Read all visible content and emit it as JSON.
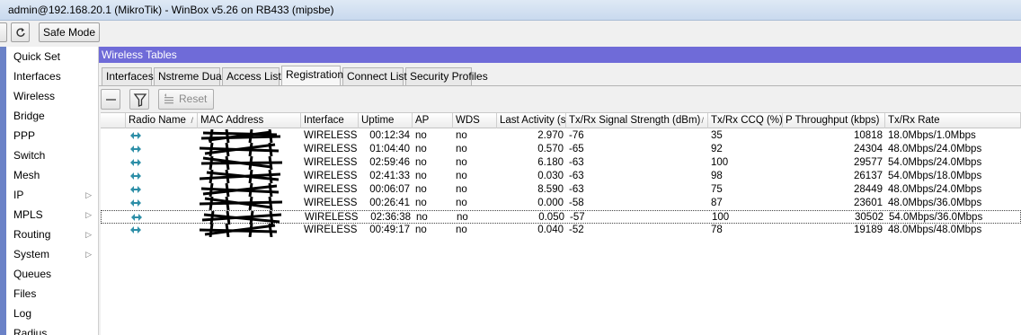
{
  "titlebar": {
    "title": "admin@192.168.20.1 (MikroTik) - WinBox v5.26 on RB433 (mipsbe)"
  },
  "toolbar": {
    "safe_mode_label": "Safe Mode"
  },
  "menu": {
    "items": [
      {
        "label": "Quick Set",
        "submenu": false
      },
      {
        "label": "Interfaces",
        "submenu": false
      },
      {
        "label": "Wireless",
        "submenu": false
      },
      {
        "label": "Bridge",
        "submenu": false
      },
      {
        "label": "PPP",
        "submenu": false
      },
      {
        "label": "Switch",
        "submenu": false
      },
      {
        "label": "Mesh",
        "submenu": false
      },
      {
        "label": "IP",
        "submenu": true
      },
      {
        "label": "MPLS",
        "submenu": true
      },
      {
        "label": "Routing",
        "submenu": true
      },
      {
        "label": "System",
        "submenu": true
      },
      {
        "label": "Queues",
        "submenu": false
      },
      {
        "label": "Files",
        "submenu": false
      },
      {
        "label": "Log",
        "submenu": false
      },
      {
        "label": "Radius",
        "submenu": false
      }
    ]
  },
  "window": {
    "title": "Wireless Tables",
    "tabs": [
      "Interfaces",
      "Nstreme Dual",
      "Access List",
      "Registration",
      "Connect List",
      "Security Profiles"
    ],
    "active_tab": "Registration",
    "reset_label": "Reset"
  },
  "table": {
    "columns": [
      "Radio Name",
      "MAC Address",
      "Interface",
      "Uptime",
      "AP",
      "WDS",
      "Last Activity (s)",
      "Tx/Rx Signal Strength (dBm)",
      "Tx/Rx CCQ (%)",
      "P Throughput (kbps)",
      "Tx/Rx Rate"
    ],
    "rows": [
      {
        "radio_name": "",
        "mac": "",
        "interface": "WIRELESS",
        "uptime": "00:12:34",
        "ap": "no",
        "wds": "no",
        "last_activity": "2.970",
        "signal": "-76",
        "ccq": "35",
        "throughput": "10818",
        "rate": "18.0Mbps/1.0Mbps"
      },
      {
        "radio_name": "",
        "mac": "",
        "interface": "WIRELESS",
        "uptime": "01:04:40",
        "ap": "no",
        "wds": "no",
        "last_activity": "0.570",
        "signal": "-65",
        "ccq": "92",
        "throughput": "24304",
        "rate": "48.0Mbps/24.0Mbps"
      },
      {
        "radio_name": "",
        "mac": "",
        "interface": "WIRELESS",
        "uptime": "02:59:46",
        "ap": "no",
        "wds": "no",
        "last_activity": "6.180",
        "signal": "-63",
        "ccq": "100",
        "throughput": "29577",
        "rate": "54.0Mbps/24.0Mbps"
      },
      {
        "radio_name": "",
        "mac": "",
        "interface": "WIRELESS",
        "uptime": "02:41:33",
        "ap": "no",
        "wds": "no",
        "last_activity": "0.030",
        "signal": "-63",
        "ccq": "98",
        "throughput": "26137",
        "rate": "54.0Mbps/18.0Mbps"
      },
      {
        "radio_name": "",
        "mac": "",
        "interface": "WIRELESS",
        "uptime": "00:06:07",
        "ap": "no",
        "wds": "no",
        "last_activity": "8.590",
        "signal": "-63",
        "ccq": "75",
        "throughput": "28449",
        "rate": "48.0Mbps/24.0Mbps"
      },
      {
        "radio_name": "",
        "mac": "",
        "interface": "WIRELESS",
        "uptime": "00:26:41",
        "ap": "no",
        "wds": "no",
        "last_activity": "0.000",
        "signal": "-58",
        "ccq": "87",
        "throughput": "23601",
        "rate": "48.0Mbps/36.0Mbps"
      },
      {
        "radio_name": "",
        "mac": "",
        "interface": "WIRELESS",
        "uptime": "02:36:38",
        "ap": "no",
        "wds": "no",
        "last_activity": "0.050",
        "signal": "-57",
        "ccq": "100",
        "throughput": "30502",
        "rate": "54.0Mbps/36.0Mbps"
      },
      {
        "radio_name": "",
        "mac": "",
        "interface": "WIRELESS",
        "uptime": "00:49:17",
        "ap": "no",
        "wds": "no",
        "last_activity": "0.040",
        "signal": "-52",
        "ccq": "78",
        "throughput": "19189",
        "rate": "48.0Mbps/48.0Mbps"
      }
    ],
    "selected_row": 6
  },
  "colors": {
    "menu_bar": "#6b82c7",
    "window_title": "#6f6bd8",
    "station_icon": "#2e8fa8"
  },
  "icons": {
    "back": "back-icon",
    "redo": "redo-icon",
    "remove": "minus-icon",
    "filter": "filter-icon",
    "reset": "reset-icon",
    "station": "wireless-station-icon",
    "submenu": "chevron-right-icon"
  }
}
